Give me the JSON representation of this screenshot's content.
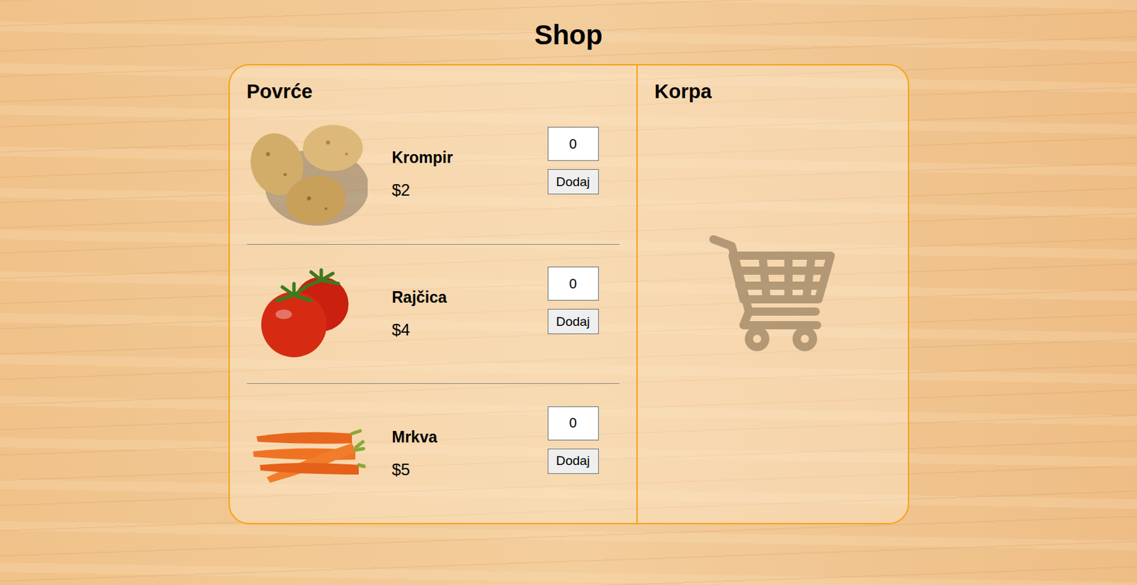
{
  "title": "Shop",
  "products": {
    "heading": "Povrće",
    "items": [
      {
        "kind": "potato",
        "name": "Krompir",
        "price": "$2",
        "quantity": "0",
        "button": "Dodaj"
      },
      {
        "kind": "tomato",
        "name": "Rajčica",
        "price": "$4",
        "quantity": "0",
        "button": "Dodaj"
      },
      {
        "kind": "carrot",
        "name": "Mrkva",
        "price": "$5",
        "quantity": "0",
        "button": "Dodaj"
      }
    ]
  },
  "cart": {
    "heading": "Korpa"
  }
}
